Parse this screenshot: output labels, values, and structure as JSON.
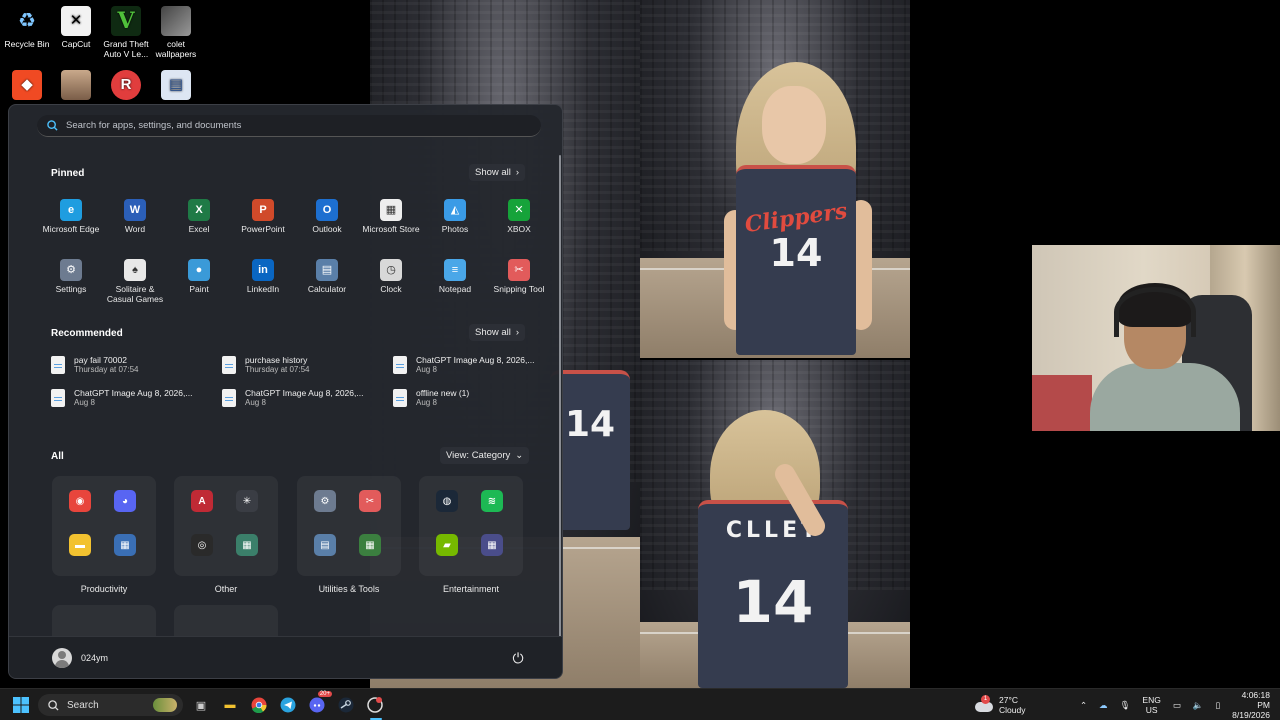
{
  "desktop_icons": [
    {
      "label": "Recycle Bin",
      "icon": "recycle-bin-icon"
    },
    {
      "label": "CapCut",
      "icon": "capcut-icon"
    },
    {
      "label": "Grand Theft Auto V Le...",
      "icon": "gta-icon"
    },
    {
      "label": "colet wallpapers",
      "icon": "folder-photo-icon"
    },
    {
      "label": "",
      "icon": "brave-icon"
    },
    {
      "label": "",
      "icon": "photo-icon"
    },
    {
      "label": "",
      "icon": "app-icon"
    },
    {
      "label": "",
      "icon": "app-icon-2"
    }
  ],
  "start_menu": {
    "search_placeholder": "Search for apps, settings, and documents",
    "pinned": {
      "title": "Pinned",
      "show_all": "Show all",
      "apps": [
        {
          "label": "Microsoft Edge",
          "icon": "edge-icon",
          "color": "#1f9de0",
          "glyph": "e"
        },
        {
          "label": "Word",
          "icon": "word-icon",
          "color": "#2b5fb8",
          "glyph": "W"
        },
        {
          "label": "Excel",
          "icon": "excel-icon",
          "color": "#1f7a46",
          "glyph": "X"
        },
        {
          "label": "PowerPoint",
          "icon": "powerpoint-icon",
          "color": "#d04a2a",
          "glyph": "P"
        },
        {
          "label": "Outlook",
          "icon": "outlook-icon",
          "color": "#1d6fd0",
          "glyph": "O"
        },
        {
          "label": "Microsoft Store",
          "icon": "store-icon",
          "color": "#eeeeee",
          "glyph": "▦"
        },
        {
          "label": "Photos",
          "icon": "photos-icon",
          "color": "#3a9be6",
          "glyph": "◭"
        },
        {
          "label": "XBOX",
          "icon": "xbox-icon",
          "color": "#16a33a",
          "glyph": "✕"
        },
        {
          "label": "Settings",
          "icon": "gear-icon",
          "color": "#6d7b90",
          "glyph": "⚙"
        },
        {
          "label": "Solitaire & Casual Games",
          "icon": "solitaire-icon",
          "color": "#e8e8e8",
          "glyph": "♠"
        },
        {
          "label": "Paint",
          "icon": "paint-icon",
          "color": "#3a9ad8",
          "glyph": "●"
        },
        {
          "label": "LinkedIn",
          "icon": "linkedin-icon",
          "color": "#0a66c2",
          "glyph": "in"
        },
        {
          "label": "Calculator",
          "icon": "calculator-icon",
          "color": "#5a7fa8",
          "glyph": "▤"
        },
        {
          "label": "Clock",
          "icon": "clock-icon",
          "color": "#d8d8d8",
          "glyph": "◷"
        },
        {
          "label": "Notepad",
          "icon": "notepad-icon",
          "color": "#4aa7e8",
          "glyph": "≡"
        },
        {
          "label": "Snipping Tool",
          "icon": "snipping-tool-icon",
          "color": "#e25b5b",
          "glyph": "✂"
        }
      ]
    },
    "recommended": {
      "title": "Recommended",
      "show_all": "Show all",
      "items": [
        {
          "name": "pay fail 70002",
          "sub": "Thursday at 07:54"
        },
        {
          "name": "purchase history",
          "sub": "Thursday at 07:54"
        },
        {
          "name": "ChatGPT Image Aug 8, 2026,...",
          "sub": "Aug 8"
        },
        {
          "name": "ChatGPT Image Aug 8, 2026,...",
          "sub": "Aug 8"
        },
        {
          "name": "ChatGPT Image Aug 8, 2026,...",
          "sub": "Aug 8"
        },
        {
          "name": "offline new (1)",
          "sub": "Aug 8"
        }
      ]
    },
    "all": {
      "title": "All",
      "view": "View: Category",
      "folders": [
        {
          "label": "Productivity",
          "icons": [
            {
              "name": "chrome-icon",
              "color": "#e8453c",
              "glyph": "◉"
            },
            {
              "name": "discord-icon",
              "color": "#5865f2",
              "glyph": "◕"
            },
            {
              "name": "file-explorer-icon",
              "color": "#f2c230",
              "glyph": "▬"
            },
            {
              "name": "apps-group-icon",
              "color": "#3a6fb5",
              "glyph": "▦"
            }
          ]
        },
        {
          "label": "Other",
          "icons": [
            {
              "name": "adobe-icon",
              "color": "#c02a35",
              "glyph": "A"
            },
            {
              "name": "sparkle-icon",
              "color": "#3a3d44",
              "glyph": "✳"
            },
            {
              "name": "obs-icon",
              "color": "#2a2a2a",
              "glyph": "◎"
            },
            {
              "name": "apps-group-icon",
              "color": "#3b7f6a",
              "glyph": "▦"
            }
          ]
        },
        {
          "label": "Utilities & Tools",
          "icons": [
            {
              "name": "gear-icon",
              "color": "#6d7b90",
              "glyph": "⚙"
            },
            {
              "name": "snipping-tool-icon",
              "color": "#e25b5b",
              "glyph": "✂"
            },
            {
              "name": "calculator-icon",
              "color": "#5a7fa8",
              "glyph": "▤"
            },
            {
              "name": "apps-group-icon",
              "color": "#3b7f3f",
              "glyph": "▦"
            }
          ]
        },
        {
          "label": "Entertainment",
          "icons": [
            {
              "name": "steam-icon",
              "color": "#1b2838",
              "glyph": "◍"
            },
            {
              "name": "spotify-icon",
              "color": "#1db954",
              "glyph": "≋"
            },
            {
              "name": "nvidia-icon",
              "color": "#76b900",
              "glyph": "▰"
            },
            {
              "name": "apps-group-icon",
              "color": "#4a4d8a",
              "glyph": "▦"
            }
          ]
        }
      ]
    },
    "user": {
      "name": "024ym"
    }
  },
  "taskbar": {
    "search_label": "Search",
    "apps": [
      {
        "name": "windows-start-icon"
      },
      {
        "name": "task-view-icon"
      },
      {
        "name": "file-explorer-icon"
      },
      {
        "name": "chrome-icon"
      },
      {
        "name": "telegram-icon"
      },
      {
        "name": "discord-icon",
        "badge": "20+"
      },
      {
        "name": "steam-icon"
      },
      {
        "name": "snipping-tool-icon"
      }
    ],
    "weather": {
      "temp": "27°C",
      "condition": "Cloudy",
      "badge": "1"
    },
    "language": {
      "line1": "ENG",
      "line2": "US"
    },
    "clock": {
      "time": "4:06:18 PM",
      "date": "8/19/2026"
    }
  },
  "colors": {
    "start_bg": "#24272d",
    "taskbar_bg": "#1c1c1c",
    "accent": "#4cc2ff"
  }
}
